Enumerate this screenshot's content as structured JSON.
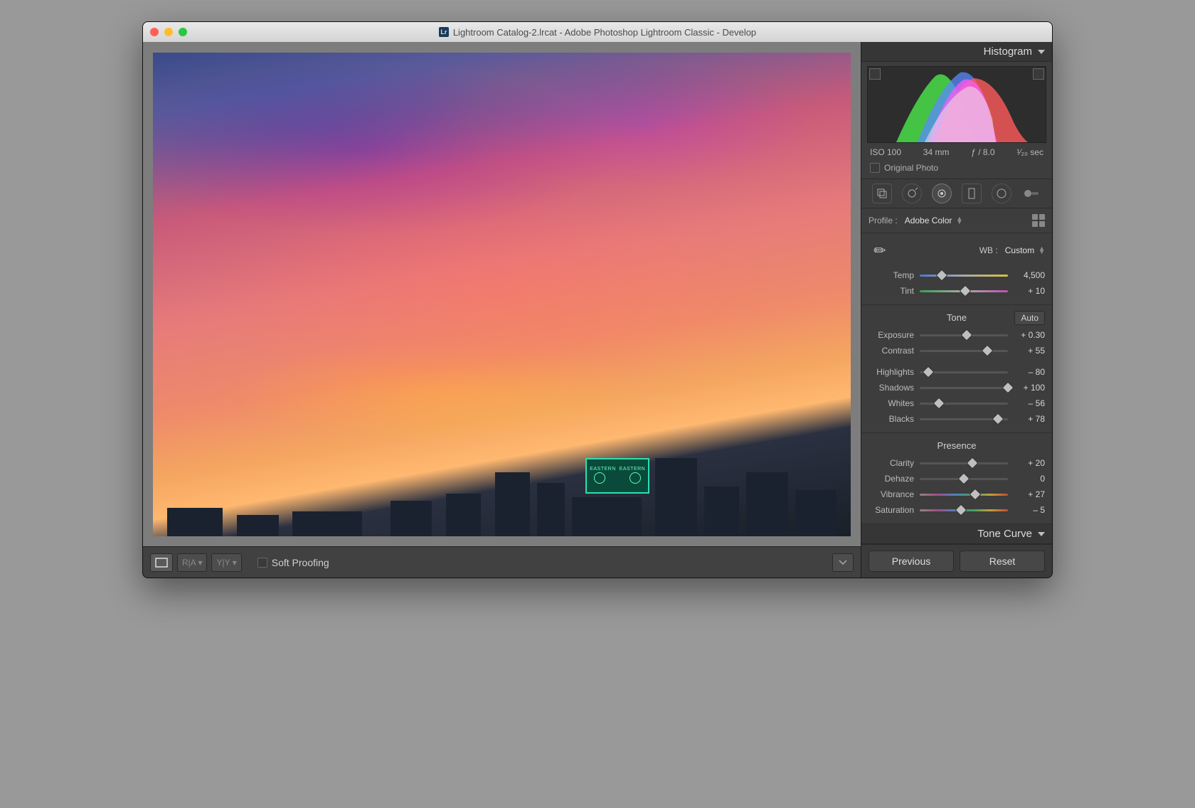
{
  "window": {
    "title": "Lightroom Catalog-2.lrcat - Adobe Photoshop Lightroom Classic - Develop"
  },
  "histogram": {
    "title": "Histogram",
    "iso": "ISO 100",
    "focal": "34 mm",
    "aperture": "ƒ / 8.0",
    "shutter": "¹⁄₂₀ sec",
    "original_label": "Original Photo"
  },
  "profile": {
    "label": "Profile :",
    "value": "Adobe Color"
  },
  "wb": {
    "label": "WB :",
    "value": "Custom"
  },
  "sliders": {
    "temp": {
      "label": "Temp",
      "value": "4,500",
      "pos": 25
    },
    "tint": {
      "label": "Tint",
      "value": "+ 10",
      "pos": 52
    },
    "exposure": {
      "label": "Exposure",
      "value": "+ 0.30",
      "pos": 53
    },
    "contrast": {
      "label": "Contrast",
      "value": "+ 55",
      "pos": 77
    },
    "highlights": {
      "label": "Highlights",
      "value": "– 80",
      "pos": 10
    },
    "shadows": {
      "label": "Shadows",
      "value": "+ 100",
      "pos": 100
    },
    "whites": {
      "label": "Whites",
      "value": "– 56",
      "pos": 22
    },
    "blacks": {
      "label": "Blacks",
      "value": "+ 78",
      "pos": 89
    },
    "clarity": {
      "label": "Clarity",
      "value": "+ 20",
      "pos": 60
    },
    "dehaze": {
      "label": "Dehaze",
      "value": "0",
      "pos": 50
    },
    "vibrance": {
      "label": "Vibrance",
      "value": "+ 27",
      "pos": 63
    },
    "saturation": {
      "label": "Saturation",
      "value": "– 5",
      "pos": 47
    }
  },
  "sections": {
    "tone": "Tone",
    "presence": "Presence",
    "auto": "Auto",
    "tone_curve": "Tone Curve"
  },
  "toolbar": {
    "soft_proofing": "Soft Proofing"
  },
  "buttons": {
    "previous": "Previous",
    "reset": "Reset"
  }
}
